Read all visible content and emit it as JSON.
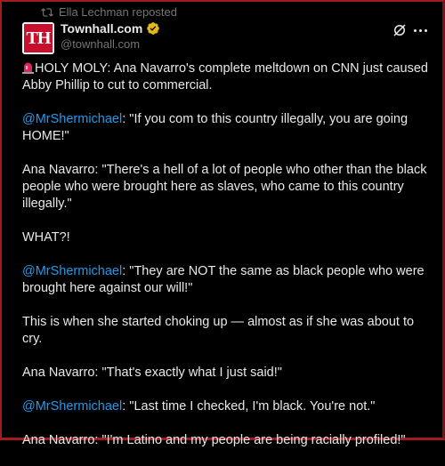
{
  "repost": {
    "icon": "repost-icon",
    "text": "Ella Lechman reposted"
  },
  "author": {
    "avatar_text": "TH",
    "name": "Townhall.com",
    "handle": "@townhall.com",
    "verified_badge": "gold-check-icon"
  },
  "colors": {
    "accent": "#1d9bf0",
    "brand": "#c8102e",
    "verified": "#e2b719"
  },
  "tweet": {
    "line1_emoji": "siren-icon",
    "line1_text": "HOLY MOLY: Ana Navarro's complete meltdown on CNN just caused Abby Phillip to cut to commercial.",
    "line2_mention": "@MrShermichael",
    "line2_text": ": \"If you com to this country illegally, you are going HOME!\"",
    "line3_text": "Ana Navarro: \"There's a hell of a lot of people who other than the black people who were brought here as slaves, who came to this country illegally.\"",
    "line4_text": "WHAT?!",
    "line5_mention": "@MrShermichael",
    "line5_text": ": \"They are NOT the same as black people who were brought here against our will!\"",
    "line6_text": "This is when she started choking up — almost as if she was about to cry.",
    "line7_text": "Ana Navarro: \"That's exactly what I just said!\"",
    "line8_mention": "@MrShermichael",
    "line8_text": ": \"Last time I checked, I'm black. You're not.\"",
    "line9_text": "Ana Navarro: \"I'm Latino and my people are being racially profiled!\""
  }
}
